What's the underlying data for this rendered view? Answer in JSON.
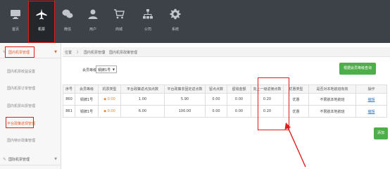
{
  "nav": {
    "items": [
      {
        "label": "首页",
        "icon": "monitor-icon"
      },
      {
        "label": "机票",
        "icon": "airplane-icon"
      },
      {
        "label": "微信",
        "icon": "wechat-icon"
      },
      {
        "label": "用户",
        "icon": "user-icon"
      },
      {
        "label": "商城",
        "icon": "cart-icon"
      },
      {
        "label": "公司",
        "icon": "org-icon"
      },
      {
        "label": "系统",
        "icon": "gear-icon"
      }
    ]
  },
  "sidebar": {
    "group_open": "国内机票管理",
    "subitems": [
      "国内机票收益设置",
      "国内机票订单管理",
      "国内机票出票管理",
      "平台政策返现管理",
      "国内特价政策管理"
    ],
    "group_closed": "国际机票管理"
  },
  "breadcrumb": {
    "home": "位置",
    "sep": "〉",
    "level1": "国内机票管理",
    "level2": "国内机票政策管理"
  },
  "filter": {
    "label": "会员等级",
    "selected": "铜牌1号"
  },
  "buttons": {
    "query": "根据会员等级查询",
    "add": "添加"
  },
  "table": {
    "headers": [
      "序号",
      "会员等级",
      "机票类型",
      "平台政策返点加点数",
      "平台政策非固定返点数",
      "留点点数",
      "留钱金额",
      "向上一级返佣点数",
      "优惠类型",
      "是否对本地航班有效",
      "操作"
    ],
    "rows": [
      [
        "860",
        "铜牌1号",
        "◆ 0.00",
        "1.00",
        "5.90",
        "0.00",
        "0.00",
        "0.20",
        "优惠",
        "不限航本地航班",
        "编辑"
      ],
      [
        "861",
        "铜牌1号",
        "◆ 0.00",
        "6.00",
        "100.00",
        "0.00",
        "0.00",
        "0.20",
        "优惠",
        "不限航本地航班",
        "编辑"
      ]
    ]
  },
  "colors": {
    "topbar": "#3d4249",
    "accent": "#e8612c",
    "green": "#4eae48",
    "highlight": "#e01b1b"
  }
}
